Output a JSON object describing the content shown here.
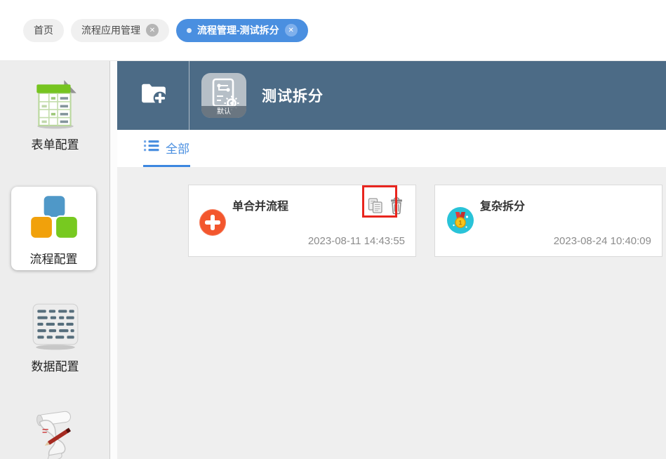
{
  "tab_strip": {
    "tabs": [
      {
        "label": "首页",
        "active": false,
        "closable": false
      },
      {
        "label": "流程应用管理",
        "active": false,
        "closable": true
      },
      {
        "label": "流程管理-测试拆分",
        "active": true,
        "closable": true
      }
    ]
  },
  "sidebar": {
    "items": [
      {
        "label": "表单配置",
        "icon": "form-table-icon",
        "selected": false
      },
      {
        "label": "流程配置",
        "icon": "process-blocks-icon",
        "selected": true
      },
      {
        "label": "数据配置",
        "icon": "data-list-icon",
        "selected": false
      },
      {
        "label": "",
        "icon": "script-scroll-icon",
        "selected": false
      }
    ]
  },
  "header": {
    "title": "测试拆分",
    "badge": "默认",
    "icons": [
      "folder-add-icon",
      "workflow-doc-icon"
    ]
  },
  "view_tabs": {
    "all_label": "全部",
    "icon": "list-icon"
  },
  "cards": [
    {
      "title": "单合并流程",
      "timestamp": "2023-08-11 14:43:55",
      "icon": "plus-circle-icon",
      "icon_color": "#f3562d",
      "actions": [
        "copy-icon",
        "delete-icon"
      ],
      "copy_highlighted": true
    },
    {
      "title": "复杂拆分",
      "timestamp": "2023-08-24 10:40:09",
      "icon": "medal-icon",
      "icon_color": "#29c3d8",
      "actions": [],
      "copy_highlighted": false
    }
  ],
  "glyphs": {
    "close": "✕"
  },
  "colors": {
    "active_tab": "#4a8fe0",
    "header_bg": "#4c6b86",
    "link_blue": "#4a8fe0",
    "card1_icon": "#f3562d",
    "card2_icon": "#29c3d8",
    "annotation_red": "#e8251e"
  }
}
